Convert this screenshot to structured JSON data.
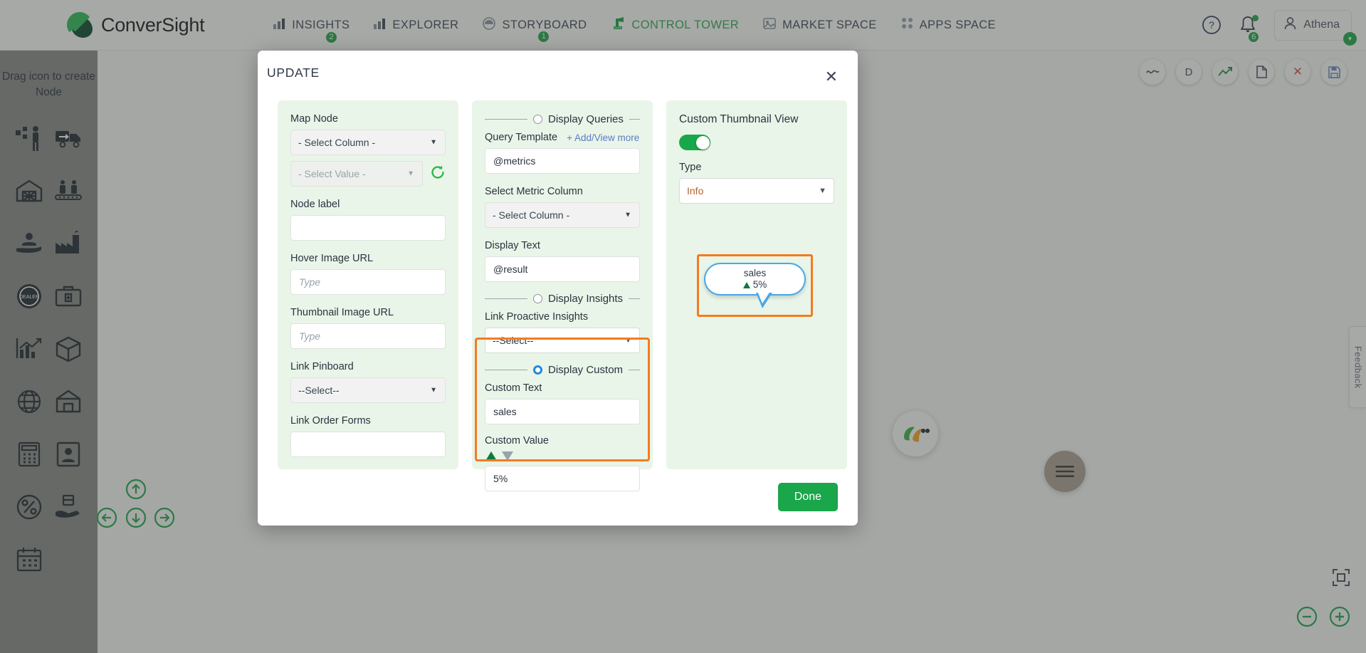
{
  "app": {
    "brand_name": "ConverSight"
  },
  "topnav": {
    "items": [
      {
        "label": "INSIGHTS",
        "icon": "bar-chart-icon",
        "badge": "2",
        "active": false
      },
      {
        "label": "EXPLORER",
        "icon": "bar-chart-icon",
        "badge": "",
        "active": false
      },
      {
        "label": "STORYBOARD",
        "icon": "storyboard-icon",
        "badge": "1",
        "active": false
      },
      {
        "label": "CONTROL TOWER",
        "icon": "control-tower-icon",
        "badge": "",
        "active": true
      },
      {
        "label": "MARKET SPACE",
        "icon": "market-space-icon",
        "badge": "",
        "active": false
      },
      {
        "label": "APPS SPACE",
        "icon": "apps-grid-icon",
        "badge": "",
        "active": false
      }
    ],
    "help_icon": "help-circle-icon",
    "notifications": {
      "icon": "bell-icon",
      "badge": "6"
    },
    "user": {
      "name": "Athena",
      "icon": "user-avatar-icon"
    }
  },
  "palette": {
    "title": "Drag icon to create Node",
    "icons": [
      "worker-nodes-icon",
      "delivery-truck-icon",
      "warehouse-icon",
      "assembly-line-icon",
      "customer-care-icon",
      "factory-icon",
      "dealer-icon",
      "medical-kit-icon",
      "analytics-chart-icon",
      "package-box-icon",
      "globe-network-icon",
      "store-house-icon",
      "calculator-icon",
      "account-user-icon",
      "discount-percent-icon",
      "handover-icon",
      "calendar-icon",
      ""
    ]
  },
  "canvas": {
    "toolbar": [
      {
        "icon": "wave-line-icon",
        "label": ""
      },
      {
        "icon": "letter-d-icon",
        "label": "D"
      },
      {
        "icon": "trend-up-icon",
        "label": ""
      },
      {
        "icon": "document-icon",
        "label": ""
      },
      {
        "icon": "close-red-icon",
        "label": "✕"
      },
      {
        "icon": "save-disk-icon",
        "label": ""
      }
    ],
    "feedback_label": "Feedback",
    "assistant_icon": "assistant-avatar-icon",
    "fab_icon": "hamburger-menu-icon",
    "pan": {
      "up": "pan-up-icon",
      "down": "pan-down-icon",
      "left": "pan-left-icon",
      "right": "pan-right-icon"
    },
    "zoom": {
      "out": "zoom-out-icon",
      "in": "zoom-in-icon",
      "fit": "fit-screen-icon"
    }
  },
  "modal": {
    "title": "UPDATE",
    "close_icon": "close-icon",
    "done_label": "Done",
    "left_column": {
      "map_node_label": "Map Node",
      "map_node_column": "- Select Column -",
      "map_node_value": "- Select Value -",
      "refresh_icon": "refresh-icon",
      "node_label_label": "Node label",
      "node_label_value": "",
      "node_label_placeholder": "",
      "hover_image_label": "Hover Image URL",
      "hover_image_value": "",
      "hover_image_placeholder": "Type",
      "thumbnail_image_label": "Thumbnail Image URL",
      "thumbnail_image_value": "",
      "thumbnail_image_placeholder": "Type",
      "link_pinboard_label": "Link Pinboard",
      "link_pinboard_value": "--Select--",
      "link_order_forms_label": "Link Order Forms",
      "link_order_forms_value": "",
      "link_order_forms_placeholder": ""
    },
    "middle_column": {
      "display_queries_title": "Display Queries",
      "display_queries_selected": false,
      "query_template_label": "Query Template",
      "add_view_more_label": "+ Add/View more",
      "query_template_value": "@metrics",
      "select_metric_label": "Select Metric Column",
      "select_metric_value": "- Select Column -",
      "display_text_label": "Display Text",
      "display_text_value": "@result",
      "display_insights_title": "Display Insights",
      "display_insights_selected": false,
      "link_proactive_label": "Link Proactive Insights",
      "link_proactive_value": "--Select--",
      "display_custom_title": "Display Custom",
      "display_custom_selected": true,
      "custom_text_label": "Custom Text",
      "custom_text_value": "sales",
      "custom_value_label": "Custom Value",
      "trend_up_icon": "triangle-up-icon",
      "trend_down_icon": "triangle-down-icon",
      "custom_value_value": "5%"
    },
    "right_column": {
      "title": "Custom Thumbnail View",
      "toggle_on": true,
      "type_label": "Type",
      "type_value": "Info",
      "preview": {
        "text": "sales",
        "trend_icon": "triangle-up-icon",
        "value": "5%"
      }
    }
  },
  "colors": {
    "brand_green": "#22a84b",
    "accent_orange": "#f47b20",
    "accent_blue": "#49a8e8",
    "panel_green": "#e9f5e8",
    "link_blue": "#5b7cc4",
    "type_text": "#b4622e"
  }
}
